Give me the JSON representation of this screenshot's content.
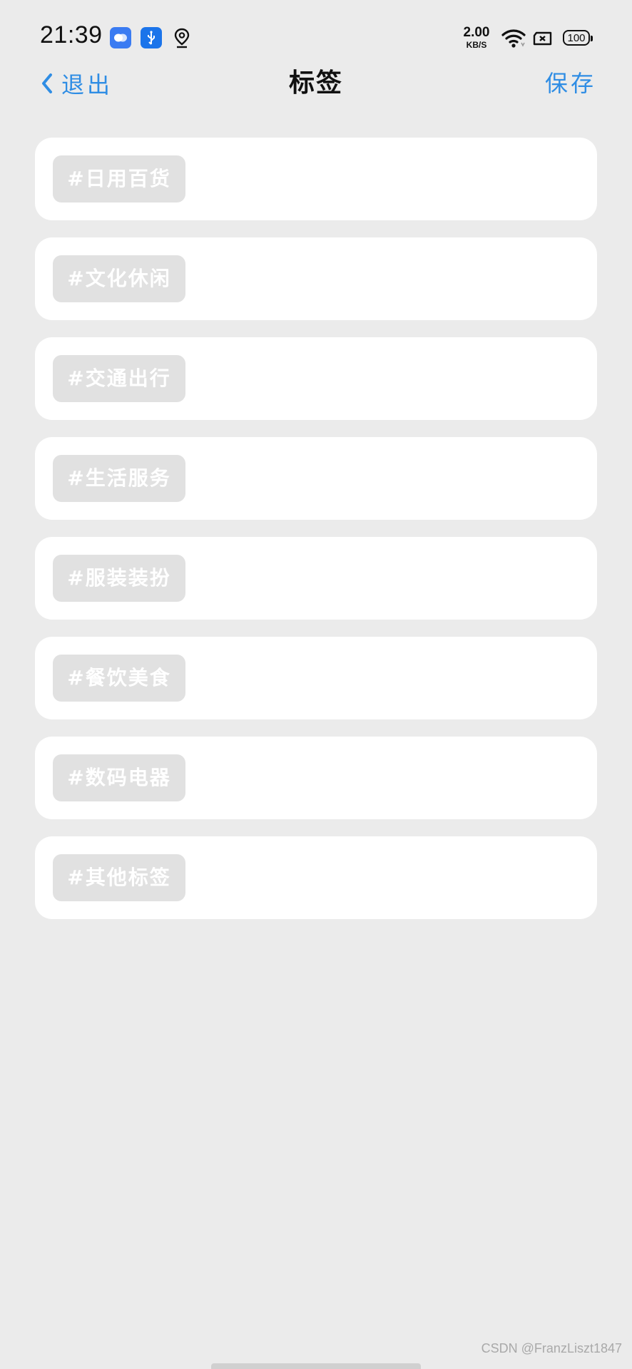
{
  "status_bar": {
    "time": "21:39",
    "speed_value": "2.00",
    "speed_unit": "KB/S",
    "battery": "100",
    "icons": [
      "app-bubble-icon",
      "usb-icon",
      "location-icon",
      "wifi-icon",
      "sim-off-icon",
      "battery-icon"
    ]
  },
  "nav": {
    "back_label": "退出",
    "title": "标签",
    "save_label": "保存"
  },
  "tags": [
    {
      "label": "#日用百货"
    },
    {
      "label": "#文化休闲"
    },
    {
      "label": "#交通出行"
    },
    {
      "label": "#生活服务"
    },
    {
      "label": "#服装装扮"
    },
    {
      "label": "#餐饮美食"
    },
    {
      "label": "#数码电器"
    },
    {
      "label": "#其他标签"
    }
  ],
  "watermark": "CSDN @FranzLiszt1847",
  "colors": {
    "accent": "#2f8de4",
    "background": "#ebebeb",
    "card": "#ffffff",
    "chip": "#e1e1e1"
  }
}
